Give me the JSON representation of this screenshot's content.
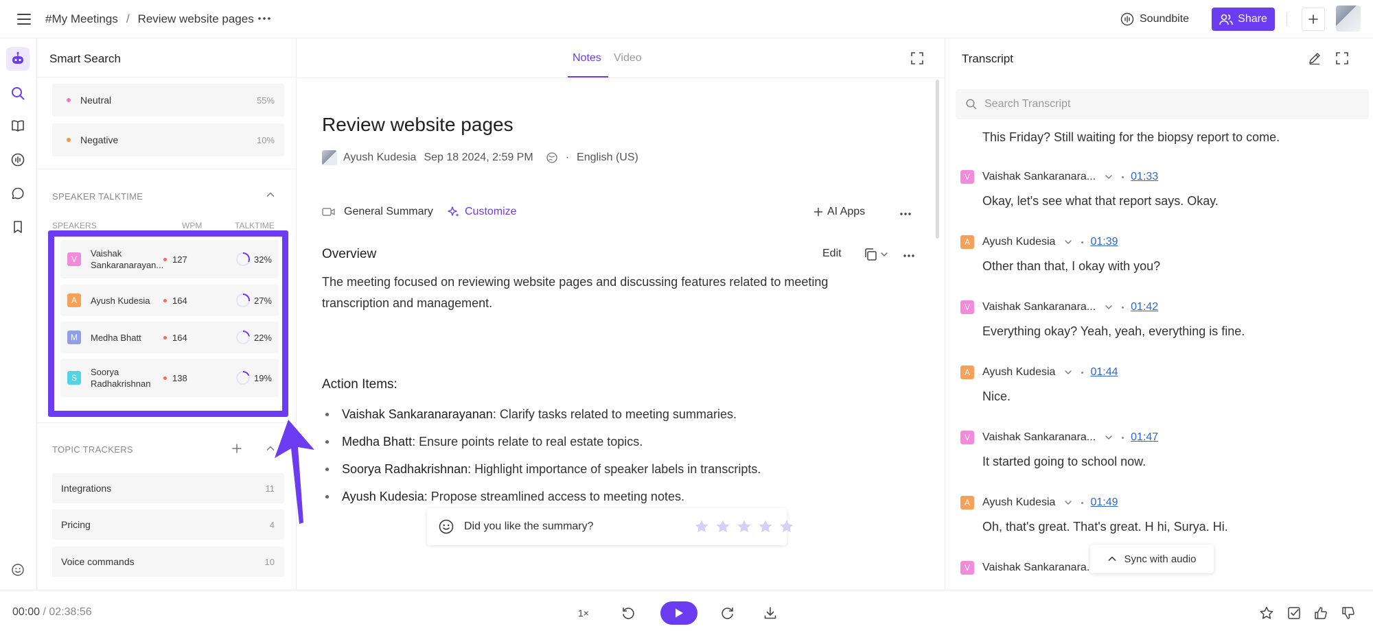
{
  "header": {
    "breadcrumb_root": "#My Meetings",
    "breadcrumb_sep": "/",
    "breadcrumb_current": "Review website pages",
    "soundbite_label": "Soundbite",
    "share_label": "Share"
  },
  "rail": {
    "icons": [
      "bot-icon",
      "search-icon",
      "book-icon",
      "soundwave-icon",
      "chat-icon",
      "bookmark-icon",
      "smiley-icon"
    ]
  },
  "smart_search": {
    "title": "Smart Search",
    "sentiments": [
      {
        "label": "Neutral",
        "pct": "55%",
        "color": "#e879c9"
      },
      {
        "label": "Negative",
        "pct": "10%",
        "color": "#f2994a"
      }
    ],
    "talktime": {
      "title": "SPEAKER TALKTIME",
      "col_speakers": "SPEAKERS",
      "col_wpm": "WPM",
      "col_talktime": "TALKTIME",
      "speakers": [
        {
          "initial": "V",
          "name": "Vaishak Sankaranarayan...",
          "wpm": "127",
          "pct": "32%",
          "share": 0.32,
          "color": "#f28bd9"
        },
        {
          "initial": "A",
          "name": "Ayush Kudesia",
          "wpm": "164",
          "pct": "27%",
          "share": 0.27,
          "color": "#f6a05a"
        },
        {
          "initial": "M",
          "name": "Medha Bhatt",
          "wpm": "164",
          "pct": "22%",
          "share": 0.22,
          "color": "#8fa0e8"
        },
        {
          "initial": "S",
          "name": "Soorya Radhakrishnan",
          "wpm": "138",
          "pct": "19%",
          "share": 0.19,
          "color": "#52d3e8"
        }
      ]
    },
    "topics": {
      "title": "TOPIC TRACKERS",
      "items": [
        {
          "label": "Integrations",
          "count": "11"
        },
        {
          "label": "Pricing",
          "count": "4"
        },
        {
          "label": "Voice commands",
          "count": "10"
        }
      ]
    }
  },
  "notes": {
    "tabs": [
      {
        "label": "Notes",
        "active": true
      },
      {
        "label": "Video",
        "active": false
      }
    ],
    "title": "Review website pages",
    "author": "Ayush Kudesia",
    "date": "Sep 18 2024, 2:59 PM",
    "bullet": "·",
    "language": "English (US)",
    "summary_type": "General Summary",
    "customize_label": "Customize",
    "ai_apps_label": "AI Apps",
    "overview_heading": "Overview",
    "edit_label": "Edit",
    "overview_text": "The meeting focused on reviewing website pages and discussing features related to meeting transcription and management.",
    "action_heading": "Action Items:",
    "action_items": [
      {
        "who": "Vaishak Sankaranarayanan",
        "what": ": Clarify tasks related to meeting summaries."
      },
      {
        "who": "Medha Bhatt",
        "what": ": Ensure points relate to real estate topics."
      },
      {
        "who": "Soorya Radhakrishnan",
        "what": ": Highlight importance of speaker labels in transcripts."
      },
      {
        "who": "Ayush Kudesia",
        "what": ": Propose streamlined access to meeting notes."
      }
    ],
    "feedback_prompt": "Did you like the summary?",
    "rating": 0
  },
  "transcript": {
    "title": "Transcript",
    "search_placeholder": "Search Transcript",
    "first_line": "This Friday? Still waiting for the biopsy report to come.",
    "entries": [
      {
        "initial": "V",
        "speaker": "Vaishak Sankaranara...",
        "time": "01:33",
        "text": "Okay, let's see what that report says. Okay.",
        "color": "#f28bd9"
      },
      {
        "initial": "A",
        "speaker": "Ayush Kudesia",
        "time": "01:39",
        "text": "Other than that, I okay with you?",
        "color": "#f6a05a"
      },
      {
        "initial": "V",
        "speaker": "Vaishak Sankaranara...",
        "time": "01:42",
        "text": "Everything okay? Yeah, yeah, everything is fine.",
        "color": "#f28bd9"
      },
      {
        "initial": "A",
        "speaker": "Ayush Kudesia",
        "time": "01:44",
        "text": "Nice.",
        "color": "#f6a05a"
      },
      {
        "initial": "V",
        "speaker": "Vaishak Sankaranara...",
        "time": "01:47",
        "text": "It started going to school now.",
        "color": "#f28bd9"
      },
      {
        "initial": "A",
        "speaker": "Ayush Kudesia",
        "time": "01:49",
        "text": "Oh, that's great. That's great. H hi, Surya. Hi.",
        "color": "#f6a05a"
      },
      {
        "initial": "V",
        "speaker": "Vaishak Sankaranara...",
        "time": "",
        "text": "",
        "color": "#f28bd9"
      }
    ],
    "sync_label": "Sync with audio"
  },
  "player": {
    "current": "00:00",
    "sep": "/",
    "total": "02:38:56",
    "speed": "1×"
  },
  "colors": {
    "accent": "#6c3cf0",
    "link": "#2f66d6"
  }
}
